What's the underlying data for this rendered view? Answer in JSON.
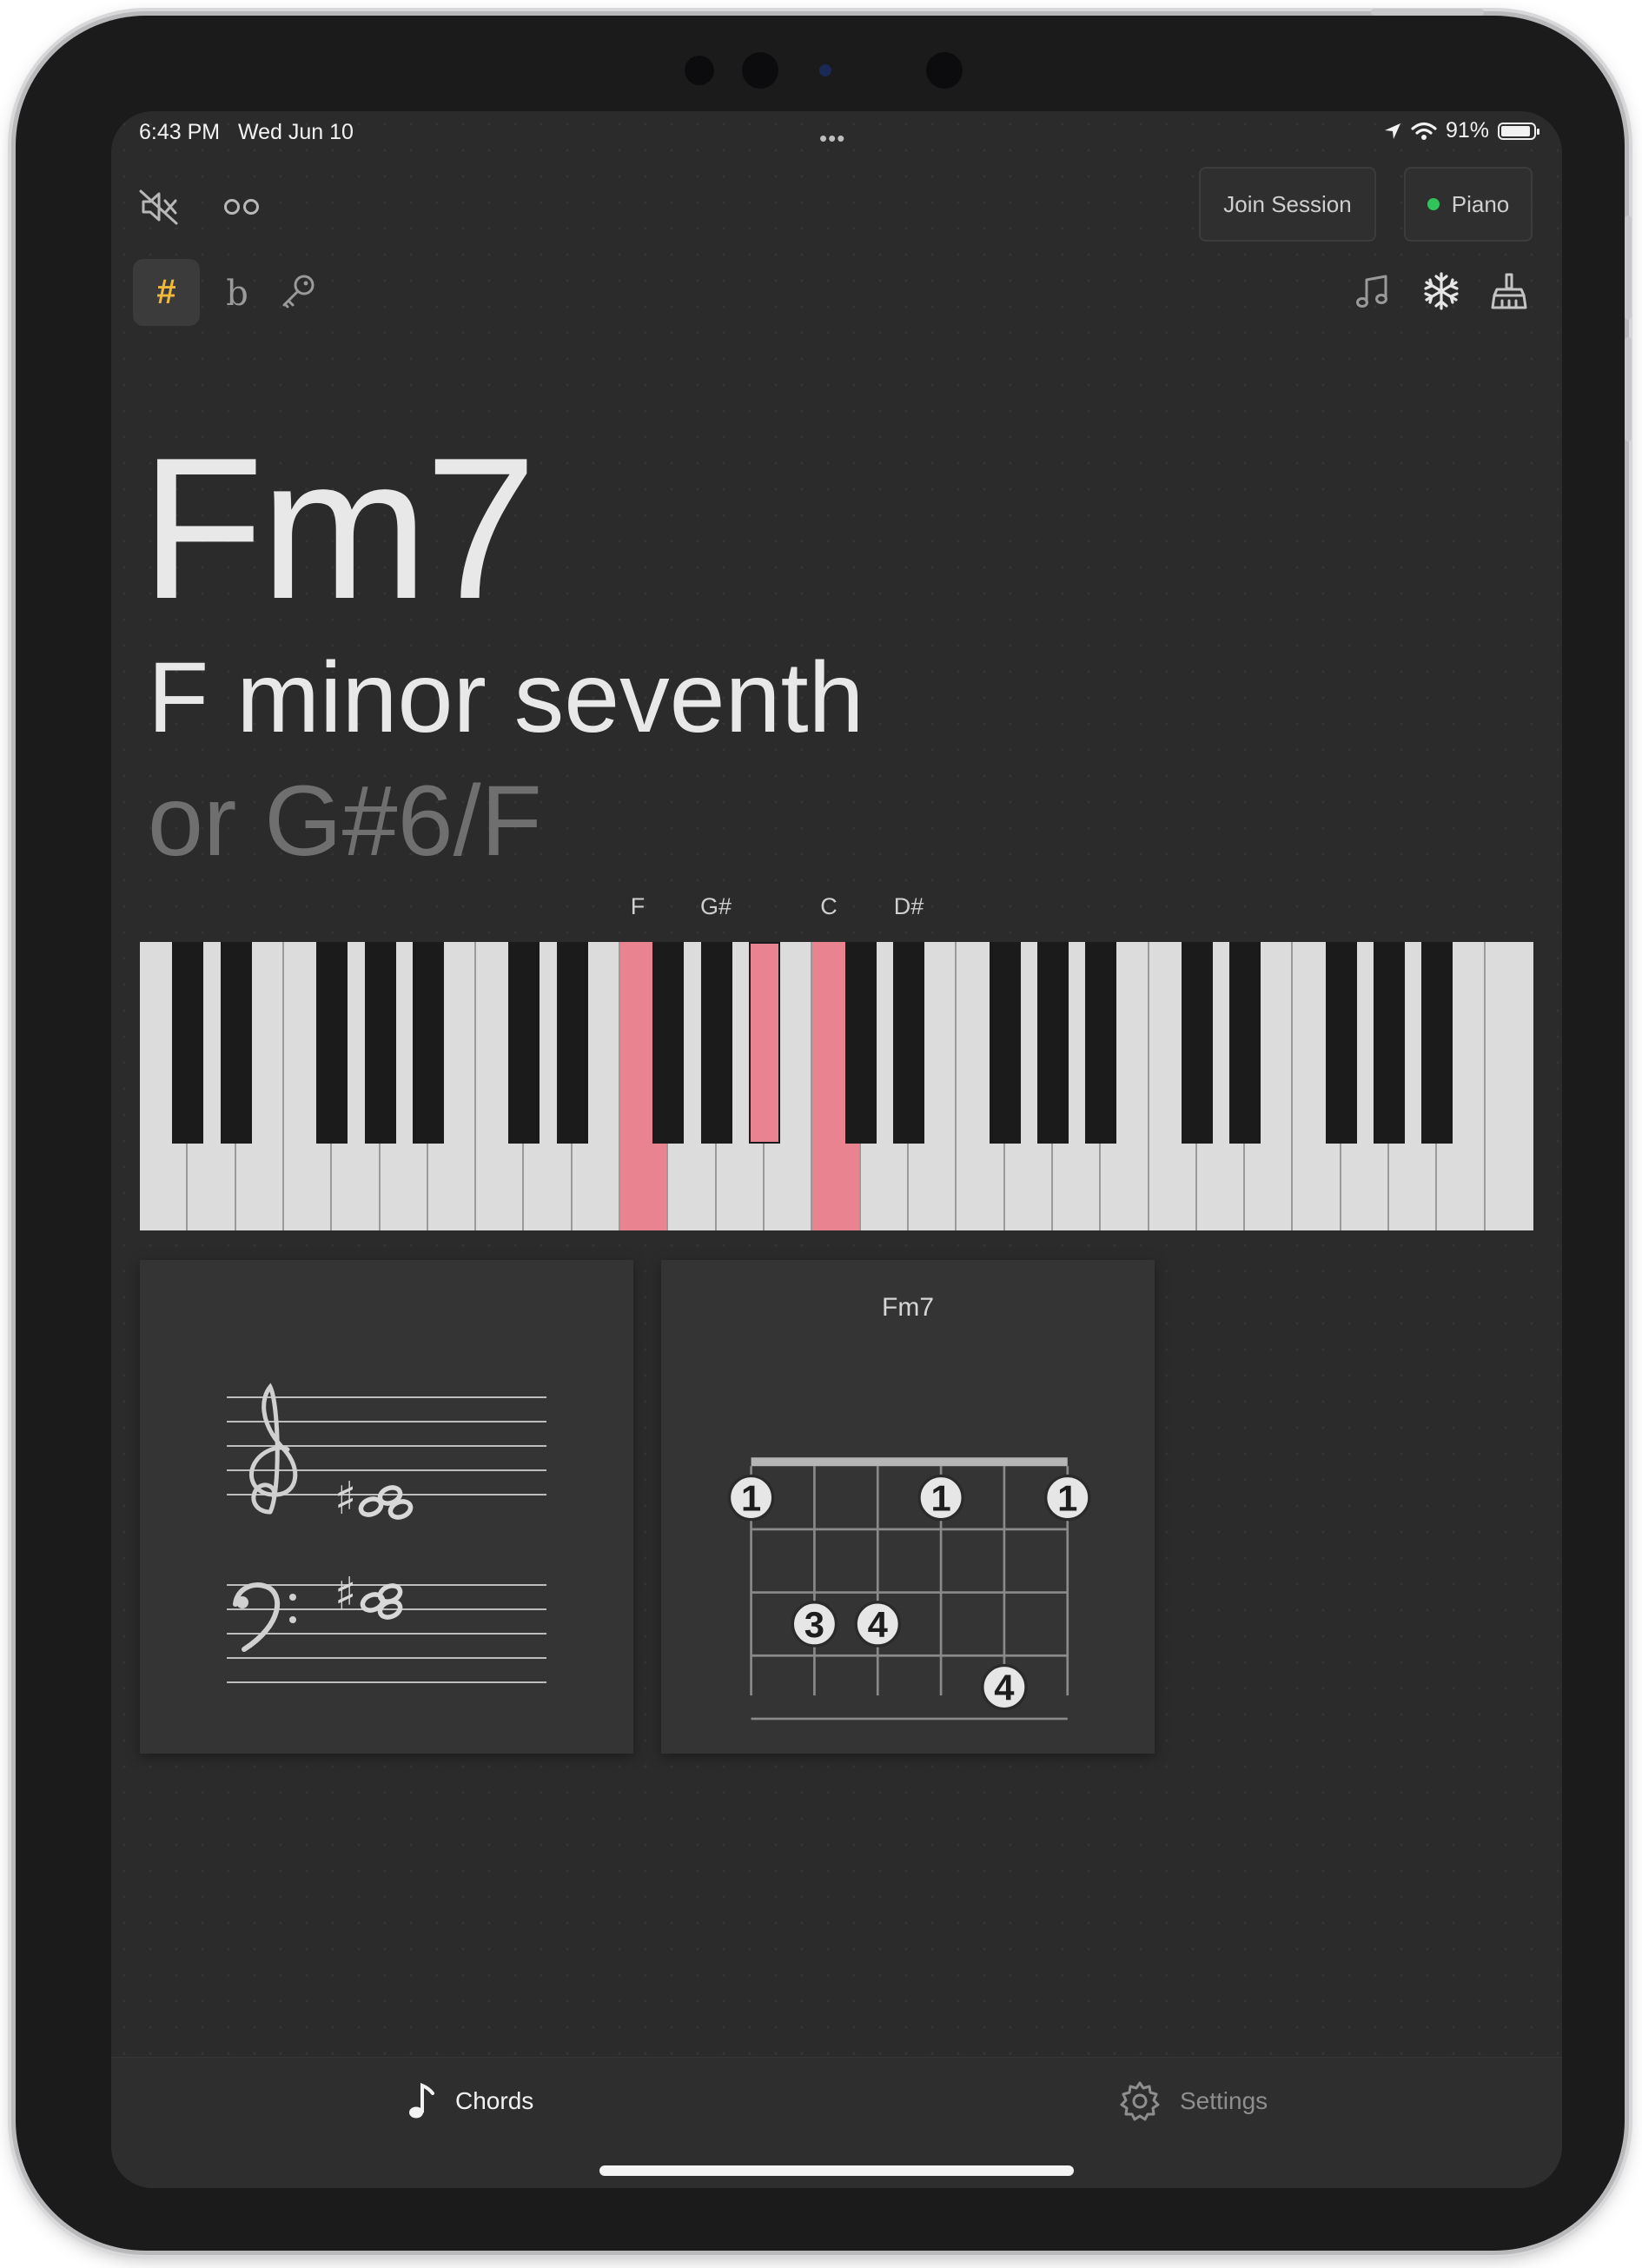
{
  "status_bar": {
    "time": "6:43 PM",
    "date": "Wed Jun 10",
    "battery": "91%",
    "battery_level": 0.91,
    "multitask": "•••"
  },
  "toolbar": {
    "mute_icon": "speaker-muted-icon",
    "glasses_icon": "glasses-icon",
    "join_session": "Join Session",
    "instrument": "Piano",
    "instrument_status_color": "#31c45a"
  },
  "accidentals": {
    "sharp": "#",
    "flat": "b",
    "key_icon": "key-icon",
    "active": "sharp",
    "active_color": "#f0b83a"
  },
  "tools": {
    "notes_icon": "music-notes-icon",
    "freeze_icon": "snowflake-icon",
    "clear_icon": "broom-icon"
  },
  "chord": {
    "symbol": "Fm7",
    "name": "F minor seventh",
    "alternative": "or G#6/F"
  },
  "keyboard": {
    "highlight_color": "#e8838f",
    "note_labels": [
      "F",
      "G#",
      "C",
      "D#"
    ],
    "white_keys": 29,
    "pressed_white_keys": [
      10,
      14
    ],
    "pressed_black_keys": [
      12,
      16
    ]
  },
  "notation": {
    "treble_accidental": "♯",
    "bass_accidental": "♯"
  },
  "fretboard": {
    "title": "Fm7",
    "strings": 6,
    "frets": 5,
    "barre": true,
    "markers": [
      {
        "string": 1,
        "fret": 1,
        "finger": "1"
      },
      {
        "string": 4,
        "fret": 1,
        "finger": "1"
      },
      {
        "string": 6,
        "fret": 1,
        "finger": "1"
      },
      {
        "string": 2,
        "fret": 3,
        "finger": "3"
      },
      {
        "string": 3,
        "fret": 3,
        "finger": "4"
      },
      {
        "string": 5,
        "fret": 4,
        "finger": "4"
      }
    ]
  },
  "tabbar": {
    "chords": {
      "label": "Chords",
      "icon": "music-note-icon",
      "active": true
    },
    "settings": {
      "label": "Settings",
      "icon": "gear-icon",
      "active": false
    }
  }
}
